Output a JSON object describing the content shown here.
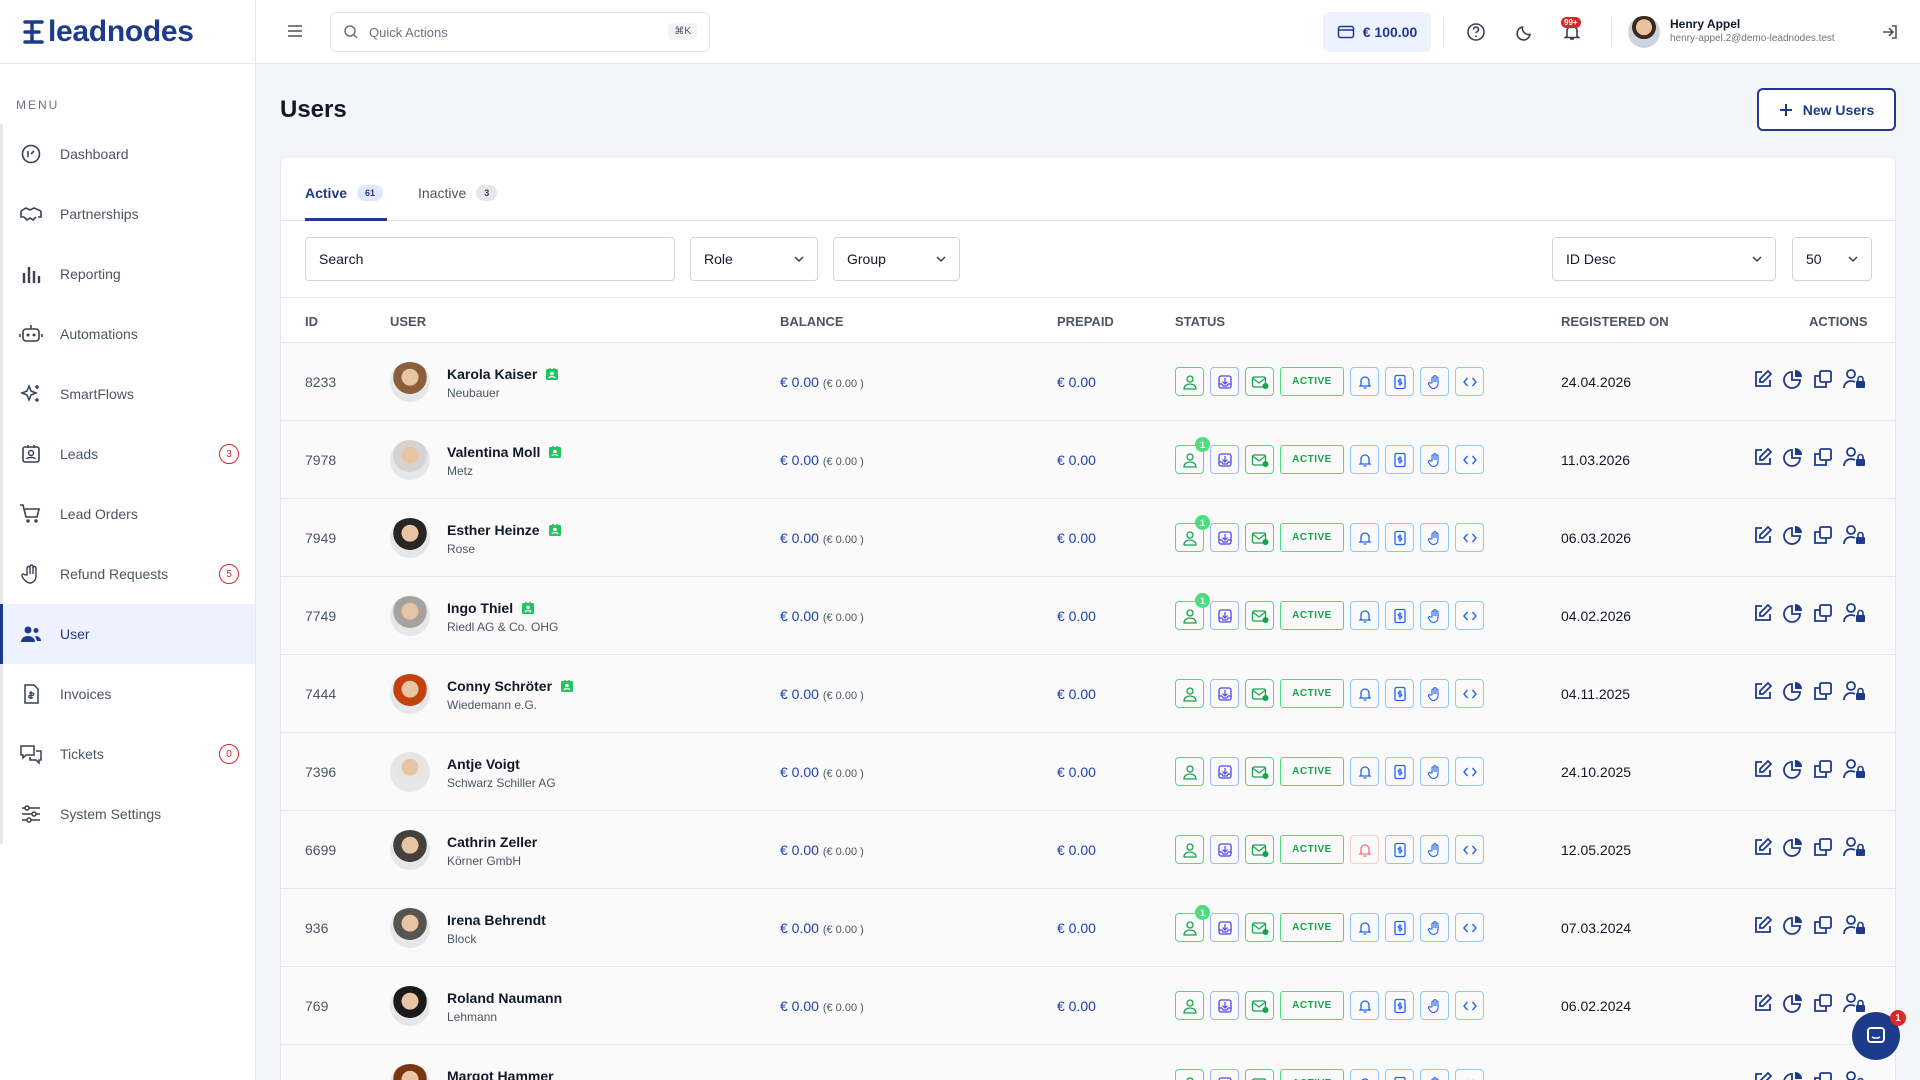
{
  "brand": {
    "name": "leadnodes"
  },
  "sidebar": {
    "menu_title": "MENU",
    "items": [
      {
        "label": "Dashboard",
        "icon": "dashboard-icon",
        "badge": ""
      },
      {
        "label": "Partnerships",
        "icon": "handshake-icon",
        "badge": ""
      },
      {
        "label": "Reporting",
        "icon": "bar-chart-icon",
        "badge": ""
      },
      {
        "label": "Automations",
        "icon": "robot-icon",
        "badge": ""
      },
      {
        "label": "SmartFlows",
        "icon": "sparkles-icon",
        "badge": ""
      },
      {
        "label": "Leads",
        "icon": "contact-card-icon",
        "badge": "3"
      },
      {
        "label": "Lead Orders",
        "icon": "cart-icon",
        "badge": ""
      },
      {
        "label": "Refund Requests",
        "icon": "hand-icon",
        "badge": "5"
      },
      {
        "label": "User",
        "icon": "users-icon",
        "badge": "",
        "active": true
      },
      {
        "label": "Invoices",
        "icon": "invoice-icon",
        "badge": ""
      },
      {
        "label": "Tickets",
        "icon": "tickets-icon",
        "badge": "0"
      },
      {
        "label": "System Settings",
        "icon": "sliders-icon",
        "badge": ""
      }
    ]
  },
  "topbar": {
    "search_placeholder": "Quick Actions",
    "shortcut": "⌘K",
    "balance": "€ 100.00",
    "notification_badge": "99+",
    "user_name": "Henry Appel",
    "user_email": "henry-appel.2@demo-leadnodes.test"
  },
  "page": {
    "title": "Users",
    "new_button": "New Users"
  },
  "tabs": [
    {
      "label": "Active",
      "count": "61"
    },
    {
      "label": "Inactive",
      "count": "3"
    }
  ],
  "filters": {
    "search": "Search",
    "role": "Role",
    "group": "Group",
    "sort": "ID Desc",
    "per_page": "50"
  },
  "columns": {
    "id": "ID",
    "user": "USER",
    "balance": "BALANCE",
    "prepaid": "PREPAID",
    "status": "STATUS",
    "registered": "REGISTERED ON",
    "actions": "ACTIONS"
  },
  "status_label": "ACTIVE",
  "rows": [
    {
      "id": "8233",
      "name": "Karola Kaiser",
      "company": "Neubauer",
      "balance": "€ 0.00",
      "balance_sub": "(€ 0.00 )",
      "prepaid": "€ 0.00",
      "date": "24.04.2026",
      "verified": true,
      "user_badge": "",
      "bell_muted": false
    },
    {
      "id": "7978",
      "name": "Valentina Moll",
      "company": "Metz",
      "balance": "€ 0.00",
      "balance_sub": "(€ 0.00 )",
      "prepaid": "€ 0.00",
      "date": "11.03.2026",
      "verified": true,
      "user_badge": "1",
      "bell_muted": false
    },
    {
      "id": "7949",
      "name": "Esther Heinze",
      "company": "Rose",
      "balance": "€ 0.00",
      "balance_sub": "(€ 0.00 )",
      "prepaid": "€ 0.00",
      "date": "06.03.2026",
      "verified": true,
      "user_badge": "1",
      "bell_muted": false
    },
    {
      "id": "7749",
      "name": "Ingo Thiel",
      "company": "Riedl AG & Co. OHG",
      "balance": "€ 0.00",
      "balance_sub": "(€ 0.00 )",
      "prepaid": "€ 0.00",
      "date": "04.02.2026",
      "verified": true,
      "user_badge": "1",
      "bell_muted": false
    },
    {
      "id": "7444",
      "name": "Conny Schröter",
      "company": "Wiedemann e.G.",
      "balance": "€ 0.00",
      "balance_sub": "(€ 0.00 )",
      "prepaid": "€ 0.00",
      "date": "04.11.2025",
      "verified": true,
      "user_badge": "",
      "bell_muted": false
    },
    {
      "id": "7396",
      "name": "Antje Voigt",
      "company": "Schwarz Schiller AG",
      "balance": "€ 0.00",
      "balance_sub": "(€ 0.00 )",
      "prepaid": "€ 0.00",
      "date": "24.10.2025",
      "verified": false,
      "user_badge": "",
      "bell_muted": false
    },
    {
      "id": "6699",
      "name": "Cathrin Zeller",
      "company": "Körner GmbH",
      "balance": "€ 0.00",
      "balance_sub": "(€ 0.00 )",
      "prepaid": "€ 0.00",
      "date": "12.05.2025",
      "verified": false,
      "user_badge": "",
      "bell_muted": true
    },
    {
      "id": "936",
      "name": "Irena Behrendt",
      "company": "Block",
      "balance": "€ 0.00",
      "balance_sub": "(€ 0.00 )",
      "prepaid": "€ 0.00",
      "date": "07.03.2024",
      "verified": false,
      "user_badge": "1",
      "bell_muted": false
    },
    {
      "id": "769",
      "name": "Roland Naumann",
      "company": "Lehmann",
      "balance": "€ 0.00",
      "balance_sub": "(€ 0.00 )",
      "prepaid": "€ 0.00",
      "date": "06.02.2024",
      "verified": false,
      "user_badge": "",
      "bell_muted": false
    },
    {
      "id": "",
      "name": "Margot Hammer",
      "company": "",
      "balance": "",
      "balance_sub": "",
      "prepaid": "",
      "date": "",
      "verified": false,
      "user_badge": "",
      "bell_muted": false
    }
  ],
  "chat": {
    "badge": "1"
  },
  "colors": {
    "brand": "#1e3a8a",
    "success": "#16a34a",
    "danger": "#dc2626"
  }
}
